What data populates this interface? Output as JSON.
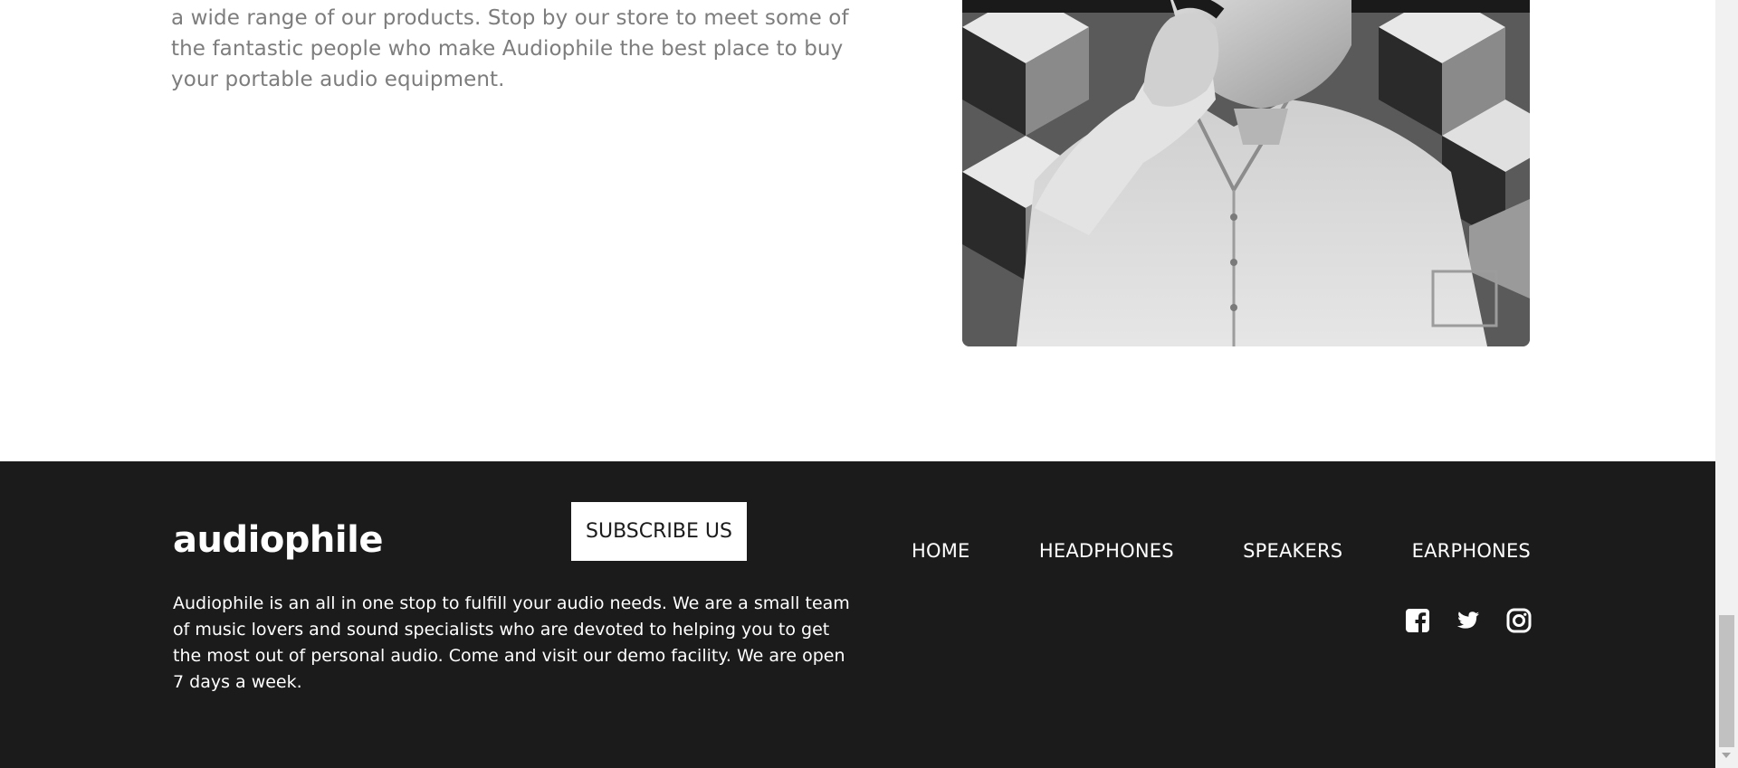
{
  "about": {
    "text": "a wide range of our products. Stop by our store to meet some of the fantastic people who make Audiophile the best place to buy your portable audio equipment."
  },
  "footer": {
    "logo": "audiophile",
    "subscribe_label": "SUBSCRIBE US",
    "nav": [
      {
        "label": "HOME"
      },
      {
        "label": "HEADPHONES"
      },
      {
        "label": "SPEAKERS"
      },
      {
        "label": "EARPHONES"
      }
    ],
    "description": "Audiophile is an all in one stop to fulfill your audio needs. We are a small team of music lovers and sound specialists who are devoted to helping you to get the most out of personal audio. Come and visit our demo facility. We are open 7 days a week.",
    "social_icons": [
      "facebook-icon",
      "twitter-icon",
      "instagram-icon"
    ]
  },
  "colors": {
    "footer_bg": "#1b1b1b",
    "body_text": "#7d7d7d",
    "white": "#ffffff"
  }
}
